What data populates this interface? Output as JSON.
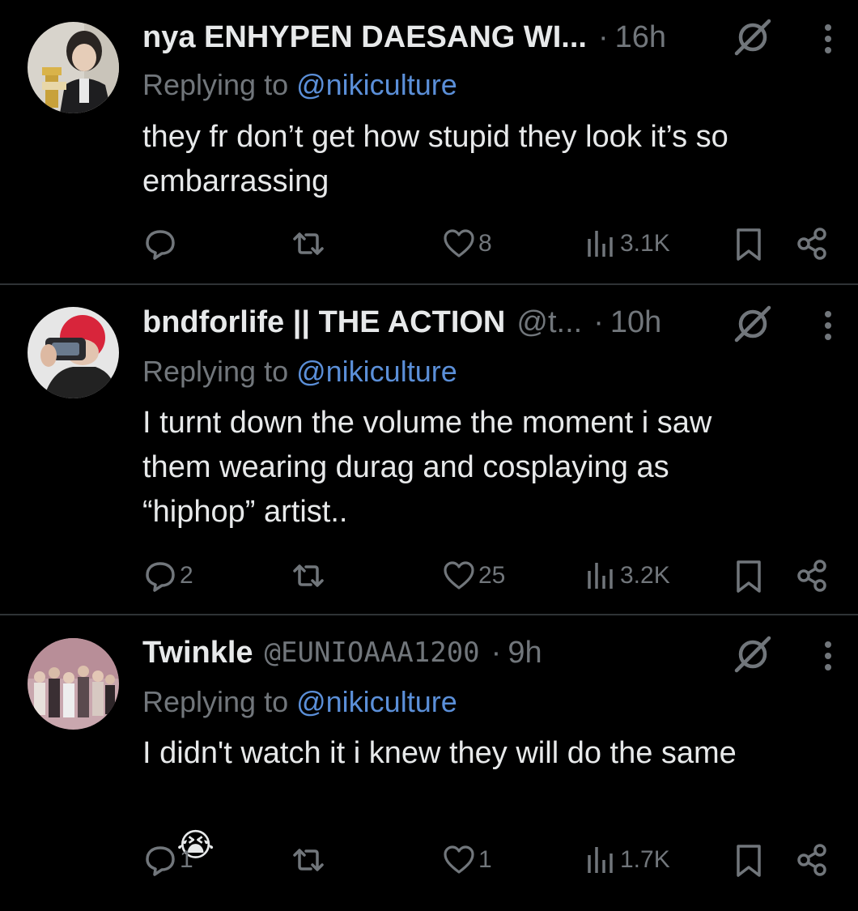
{
  "tweets": [
    {
      "name": "nya ENHYPEN DAESANG WI...",
      "handle": "",
      "time": "16h",
      "replying_prefix": "Replying to ",
      "replying_to": "@nikiculture",
      "text": "they fr don’t get how stupid they look it’s so\nembarrassing",
      "replies": "",
      "likes": "8",
      "views": "3.1K"
    },
    {
      "name": "bndforlife || THE ACTION",
      "handle": "@t...",
      "time": "10h",
      "replying_prefix": "Replying to ",
      "replying_to": "@nikiculture",
      "text": "I turnt down the volume the moment i saw\nthem wearing durag and cosplaying as\n“hiphop” artist..",
      "replies": "2",
      "likes": "25",
      "views": "3.2K"
    },
    {
      "name": "Twinkle",
      "handle": "@EUNIOAAA1200",
      "time": "9h",
      "replying_prefix": "Replying to ",
      "replying_to": "@nikiculture",
      "text": "I didn't watch it i knew they will do the same",
      "emoji": "😭",
      "replies": "1",
      "likes": "1",
      "views": "1.7K"
    }
  ],
  "icons": {
    "reply": "reply-icon",
    "repost": "repost-icon",
    "like": "heart-icon",
    "views": "views-icon",
    "bookmark": "bookmark-icon",
    "share": "share-icon",
    "grok": "grok-icon",
    "more": "more-icon"
  },
  "colors": {
    "background": "#000000",
    "text": "#e7e9ea",
    "muted": "#71767b",
    "mention": "#5b8fd8",
    "divider": "#2f3336"
  }
}
